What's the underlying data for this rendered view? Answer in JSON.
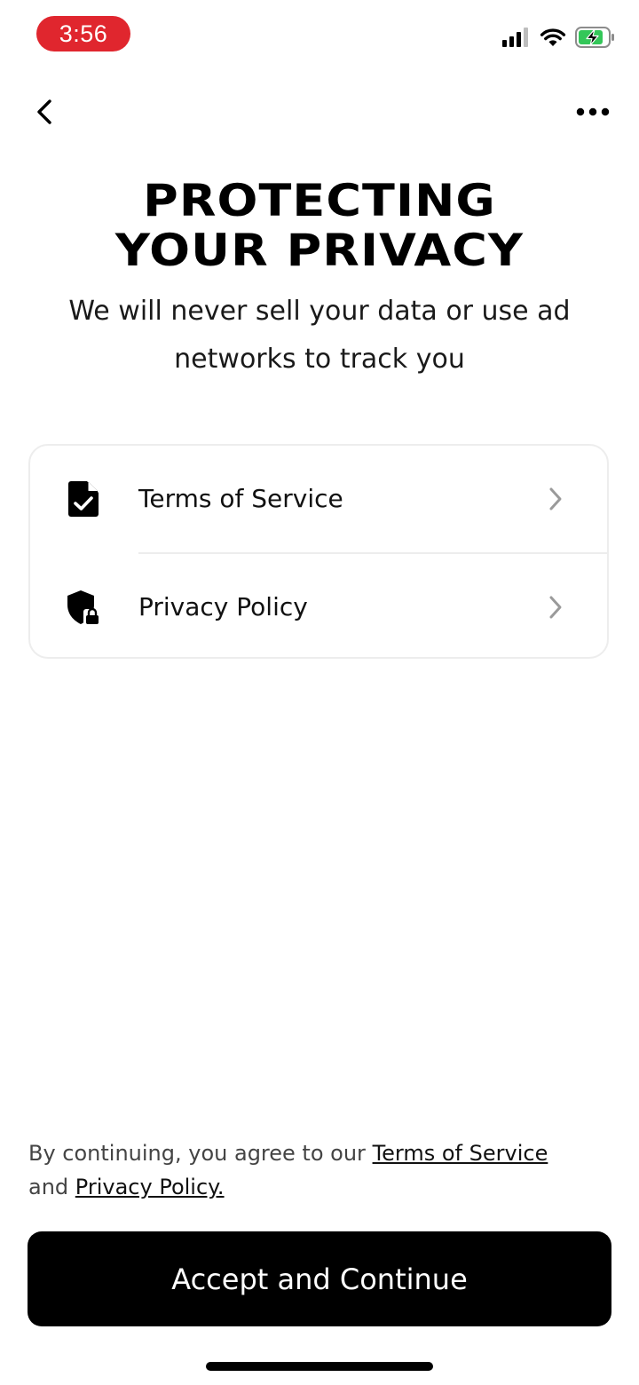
{
  "status_bar": {
    "time": "3:56",
    "icons": [
      "signal-icon",
      "wifi-icon",
      "battery-charging-icon"
    ]
  },
  "nav": {
    "back_icon": "chevron-left-icon",
    "more_icon": "more-horizontal-icon"
  },
  "header": {
    "title_line1": "PROTECTING",
    "title_line2": "YOUR PRIVACY",
    "subtitle_line1": "We will never sell your data or use ad",
    "subtitle_line2": "networks to track you"
  },
  "links": [
    {
      "label": "Terms of Service",
      "icon": "document-check-icon"
    },
    {
      "label": "Privacy Policy",
      "icon": "shield-lock-icon"
    }
  ],
  "consent": {
    "prefix": "By continuing, you agree to our",
    "terms_link": "Terms of Service",
    "middle": "and",
    "privacy_link": "Privacy Policy."
  },
  "primary_button": {
    "label": "Accept and Continue"
  },
  "colors": {
    "time_pill": "#e0262e",
    "battery_fill": "#34c759",
    "button_bg": "#000000",
    "button_text": "#ffffff",
    "chevron": "#9a9a9a",
    "card_border": "#ededed"
  }
}
